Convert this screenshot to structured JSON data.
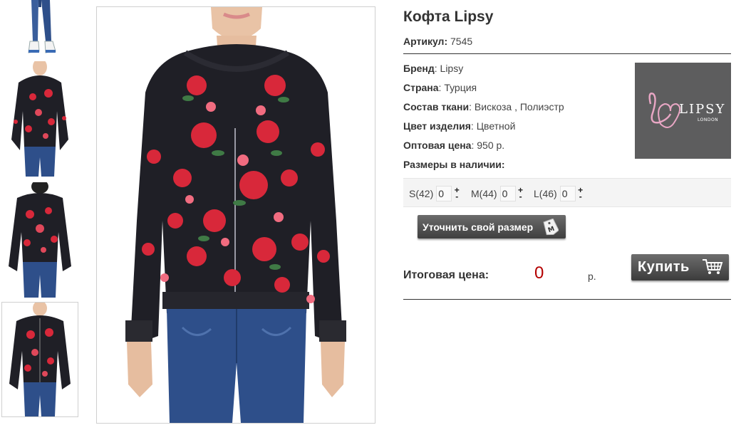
{
  "product": {
    "title": "Кофта Lipsy",
    "sku_label": "Артикул:",
    "sku_value": "7545"
  },
  "attributes": {
    "brand": {
      "label": "Бренд",
      "value": "Lipsy"
    },
    "country": {
      "label": "Страна",
      "value": "Турция"
    },
    "fabric": {
      "label": "Состав ткани",
      "value": "Вискоза , Полиэстр"
    },
    "color": {
      "label": "Цвет изделия",
      "value": "Цветной"
    },
    "wholesale_price": {
      "label": "Оптовая цена",
      "value": "950 р."
    }
  },
  "sizes_heading": "Размеры в наличии:",
  "sizes": [
    {
      "label": "S(42)",
      "qty": "0"
    },
    {
      "label": "M(44)",
      "qty": "0"
    },
    {
      "label": "L(46)",
      "qty": "0"
    }
  ],
  "stepper": {
    "plus": "+",
    "minus": "-"
  },
  "refine_size_button": "Уточнить свой размер",
  "size_tag_letter": "M",
  "total": {
    "label": "Итоговая цена:",
    "value": "0",
    "currency": "р."
  },
  "buy_button": "Купить",
  "brand_logo": {
    "wordmark": "LIPSY",
    "subtext": "LONDON",
    "monogram": "L"
  },
  "colors": {
    "accent_price": "#b40000",
    "button_dark": "#3f3f3f",
    "logo_bg": "#5d5d5e",
    "logo_pink": "#e8a6c4",
    "jacket": "#1f1f26",
    "roses": "#d8283a",
    "jeans": "#2e4f8a"
  },
  "icons": [
    "cart-icon",
    "size-tag-icon",
    "plus-icon",
    "minus-icon"
  ]
}
